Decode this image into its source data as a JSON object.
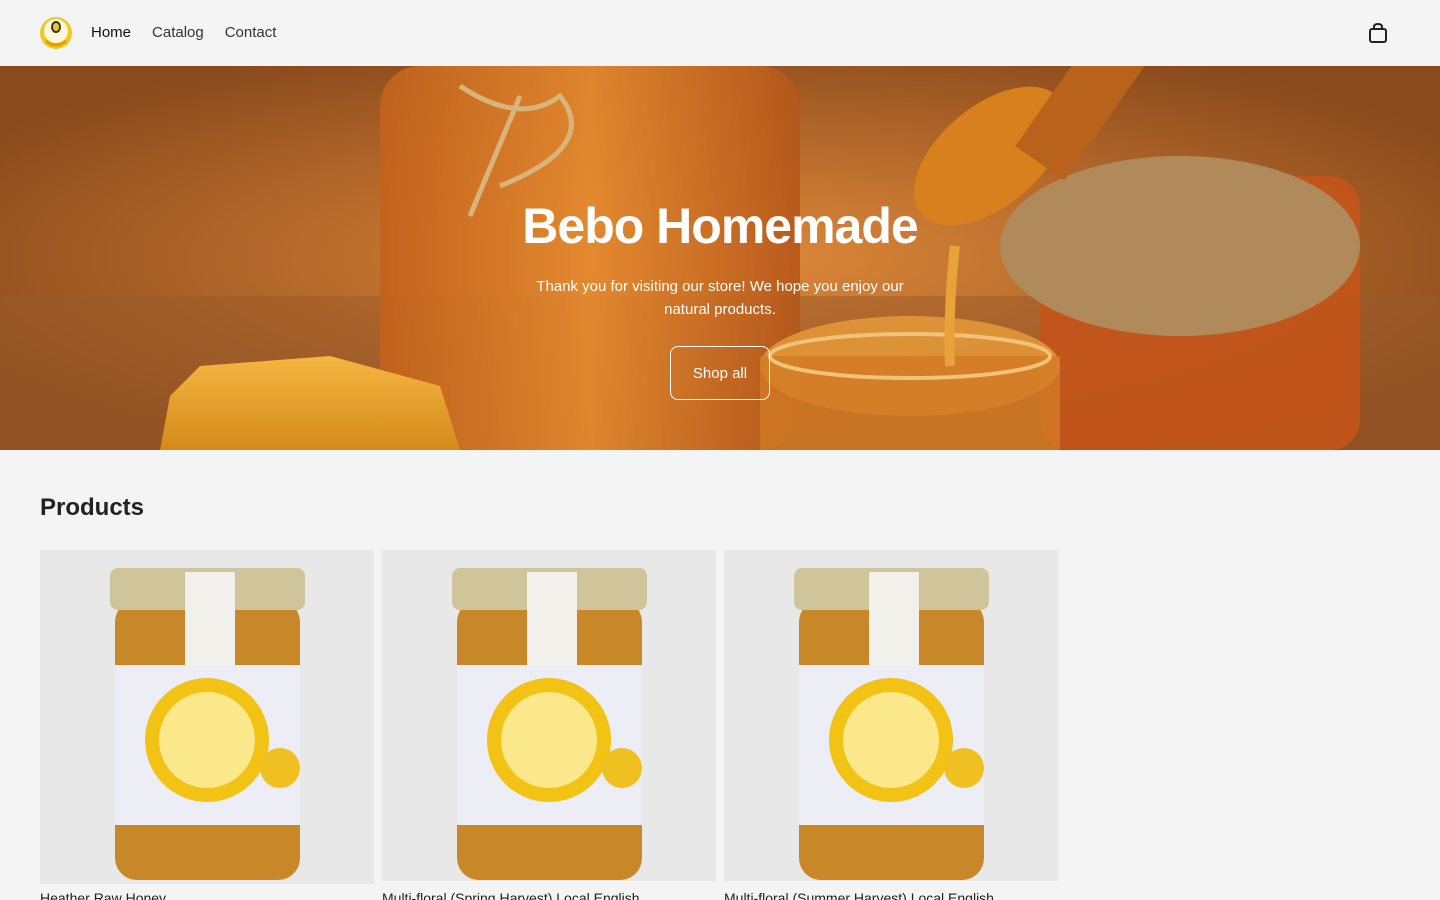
{
  "brand": {
    "name": "Bebo Homemade"
  },
  "nav": {
    "items": [
      {
        "label": "Home"
      },
      {
        "label": "Catalog"
      },
      {
        "label": "Contact"
      }
    ]
  },
  "hero": {
    "title": "Bebo Homemade",
    "subtitle": "Thank you for visiting our store! We hope you enjoy our natural products.",
    "button_label": "Shop all"
  },
  "products": {
    "title": "Products",
    "items": [
      {
        "name": "Heather Raw Honey"
      },
      {
        "name": "Multi-floral (Spring Harvest) Local English"
      },
      {
        "name": "Multi-floral (Summer Harvest) Local English"
      }
    ]
  },
  "colors": {
    "background": "#f4f4f4",
    "hero_tone": "#b86a2c",
    "honey": "#e6a020"
  },
  "icons": {
    "cart": "cart-icon",
    "logo": "bee-logo-icon"
  }
}
